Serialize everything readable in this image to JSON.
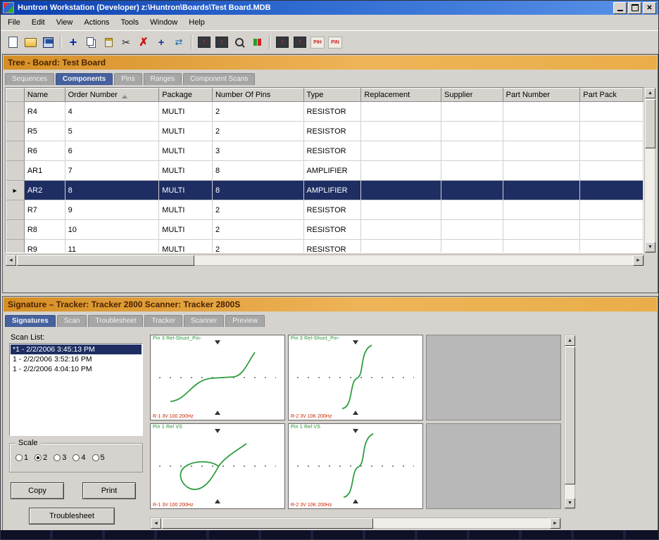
{
  "window": {
    "title": "Huntron Workstation (Developer) z:\\Huntron\\Boards\\Test Board.MDB"
  },
  "menu": {
    "items": [
      "File",
      "Edit",
      "View",
      "Actions",
      "Tools",
      "Window",
      "Help"
    ]
  },
  "toolbar": {
    "icons": [
      "new-document-icon",
      "open-folder-icon",
      "save-icon",
      "add-icon",
      "copy-icon",
      "paste-icon",
      "cut-icon",
      "delete-icon",
      "crosshair-icon",
      "swap-arrows-icon",
      "load-board-icon",
      "load-sequence-icon",
      "probe-icon",
      "start-stop-icon",
      "copy-pin-icon",
      "paste-pin-icon",
      "pih-tool-icon",
      "pin-tool-icon"
    ],
    "pih_label": "PIH",
    "pin_label": "PIN"
  },
  "tree_panel": {
    "title": "Tree - Board: Test Board",
    "tabs": [
      "Sequences",
      "Components",
      "Pins",
      "Ranges",
      "Component Scans"
    ],
    "active_tab": "Components",
    "grid": {
      "columns": [
        "Name",
        "Order Number",
        "Package",
        "Number Of Pins",
        "Type",
        "Replacement",
        "Supplier",
        "Part Number",
        "Part Pack"
      ],
      "rows": [
        [
          "R4",
          "4",
          "MULTI",
          "2",
          "RESISTOR",
          "",
          "",
          "",
          ""
        ],
        [
          "R5",
          "5",
          "MULTI",
          "2",
          "RESISTOR",
          "",
          "",
          "",
          ""
        ],
        [
          "R6",
          "6",
          "MULTI",
          "3",
          "RESISTOR",
          "",
          "",
          "",
          ""
        ],
        [
          "AR1",
          "7",
          "MULTI",
          "8",
          "AMPLIFIER",
          "",
          "",
          "",
          ""
        ],
        [
          "AR2",
          "8",
          "MULTI",
          "8",
          "AMPLIFIER",
          "",
          "",
          "",
          ""
        ],
        [
          "R7",
          "9",
          "MULTI",
          "2",
          "RESISTOR",
          "",
          "",
          "",
          ""
        ],
        [
          "R8",
          "10",
          "MULTI",
          "2",
          "RESISTOR",
          "",
          "",
          "",
          ""
        ],
        [
          "R9",
          "11",
          "MULTI",
          "2",
          "RESISTOR",
          "",
          "",
          "",
          ""
        ]
      ],
      "selected_row": "AR2",
      "selected_index": 4
    }
  },
  "signature_panel": {
    "title": "Signature – Tracker: Tracker 2800  Scanner: Tracker 2800S",
    "tabs": [
      "Signatures",
      "Scan",
      "Troublesheet",
      "Tracker",
      "Scanner",
      "Preview"
    ],
    "active_tab": "Signatures",
    "scan_list": {
      "label": "Scan List:",
      "items": [
        "*1 - 2/2/2006 3:45:13 PM",
        "1 - 2/2/2006 3:52:16 PM",
        "1 - 2/2/2006 4:04:10 PM"
      ],
      "selected_index": 0
    },
    "scale": {
      "label": "Scale",
      "options": [
        "1",
        "2",
        "3",
        "4",
        "5"
      ],
      "selected": "2"
    },
    "buttons": {
      "copy": "Copy",
      "print": "Print",
      "troublesheet": "Troublesheet"
    },
    "scopes": [
      {
        "top_label": "Pin 3  Rel-Shunt_Pin-",
        "bottom_label": "R-1 3V 100 200Hz"
      },
      {
        "top_label": "Pin 3  Rel-Shunt_Pin-",
        "bottom_label": "R-2 3V 10K 200Hz"
      },
      {
        "top_label": "Pin 1  Rel VS",
        "bottom_label": "R-1 3V 100 200Hz"
      },
      {
        "top_label": "Pin 1  Rel VS",
        "bottom_label": "R-2 3V 10K 200Hz"
      }
    ]
  },
  "colors": {
    "titlebar_blue": "#2e6ad0",
    "header_orange": "#e9ae49",
    "active_tab_blue": "#46619e",
    "selected_row_navy": "#1e2e63",
    "trace_green": "#2f9e41",
    "scope_label_red": "#cc2200",
    "scope_label_green": "#1e8f2e"
  }
}
